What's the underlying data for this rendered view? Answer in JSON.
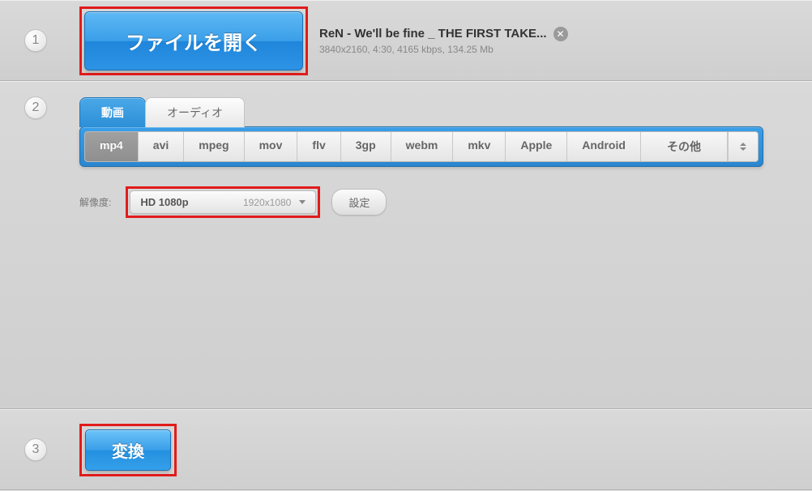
{
  "step1": {
    "number": "1",
    "open_file_label": "ファイルを開く",
    "file": {
      "title": "ReN - We'll be fine _ THE FIRST TAKE...",
      "meta": "3840x2160, 4:30, 4165 kbps, 134.25 Mb"
    }
  },
  "step2": {
    "number": "2",
    "tabs": {
      "video": "動画",
      "audio": "オーディオ"
    },
    "formats": [
      "mp4",
      "avi",
      "mpeg",
      "mov",
      "flv",
      "3gp",
      "webm",
      "mkv",
      "Apple",
      "Android"
    ],
    "other_label": "その他",
    "active_format": "mp4",
    "resolution_label": "解像度:",
    "resolution": {
      "name": "HD 1080p",
      "dim": "1920x1080"
    },
    "settings_label": "設定"
  },
  "step3": {
    "number": "3",
    "convert_label": "変換"
  }
}
